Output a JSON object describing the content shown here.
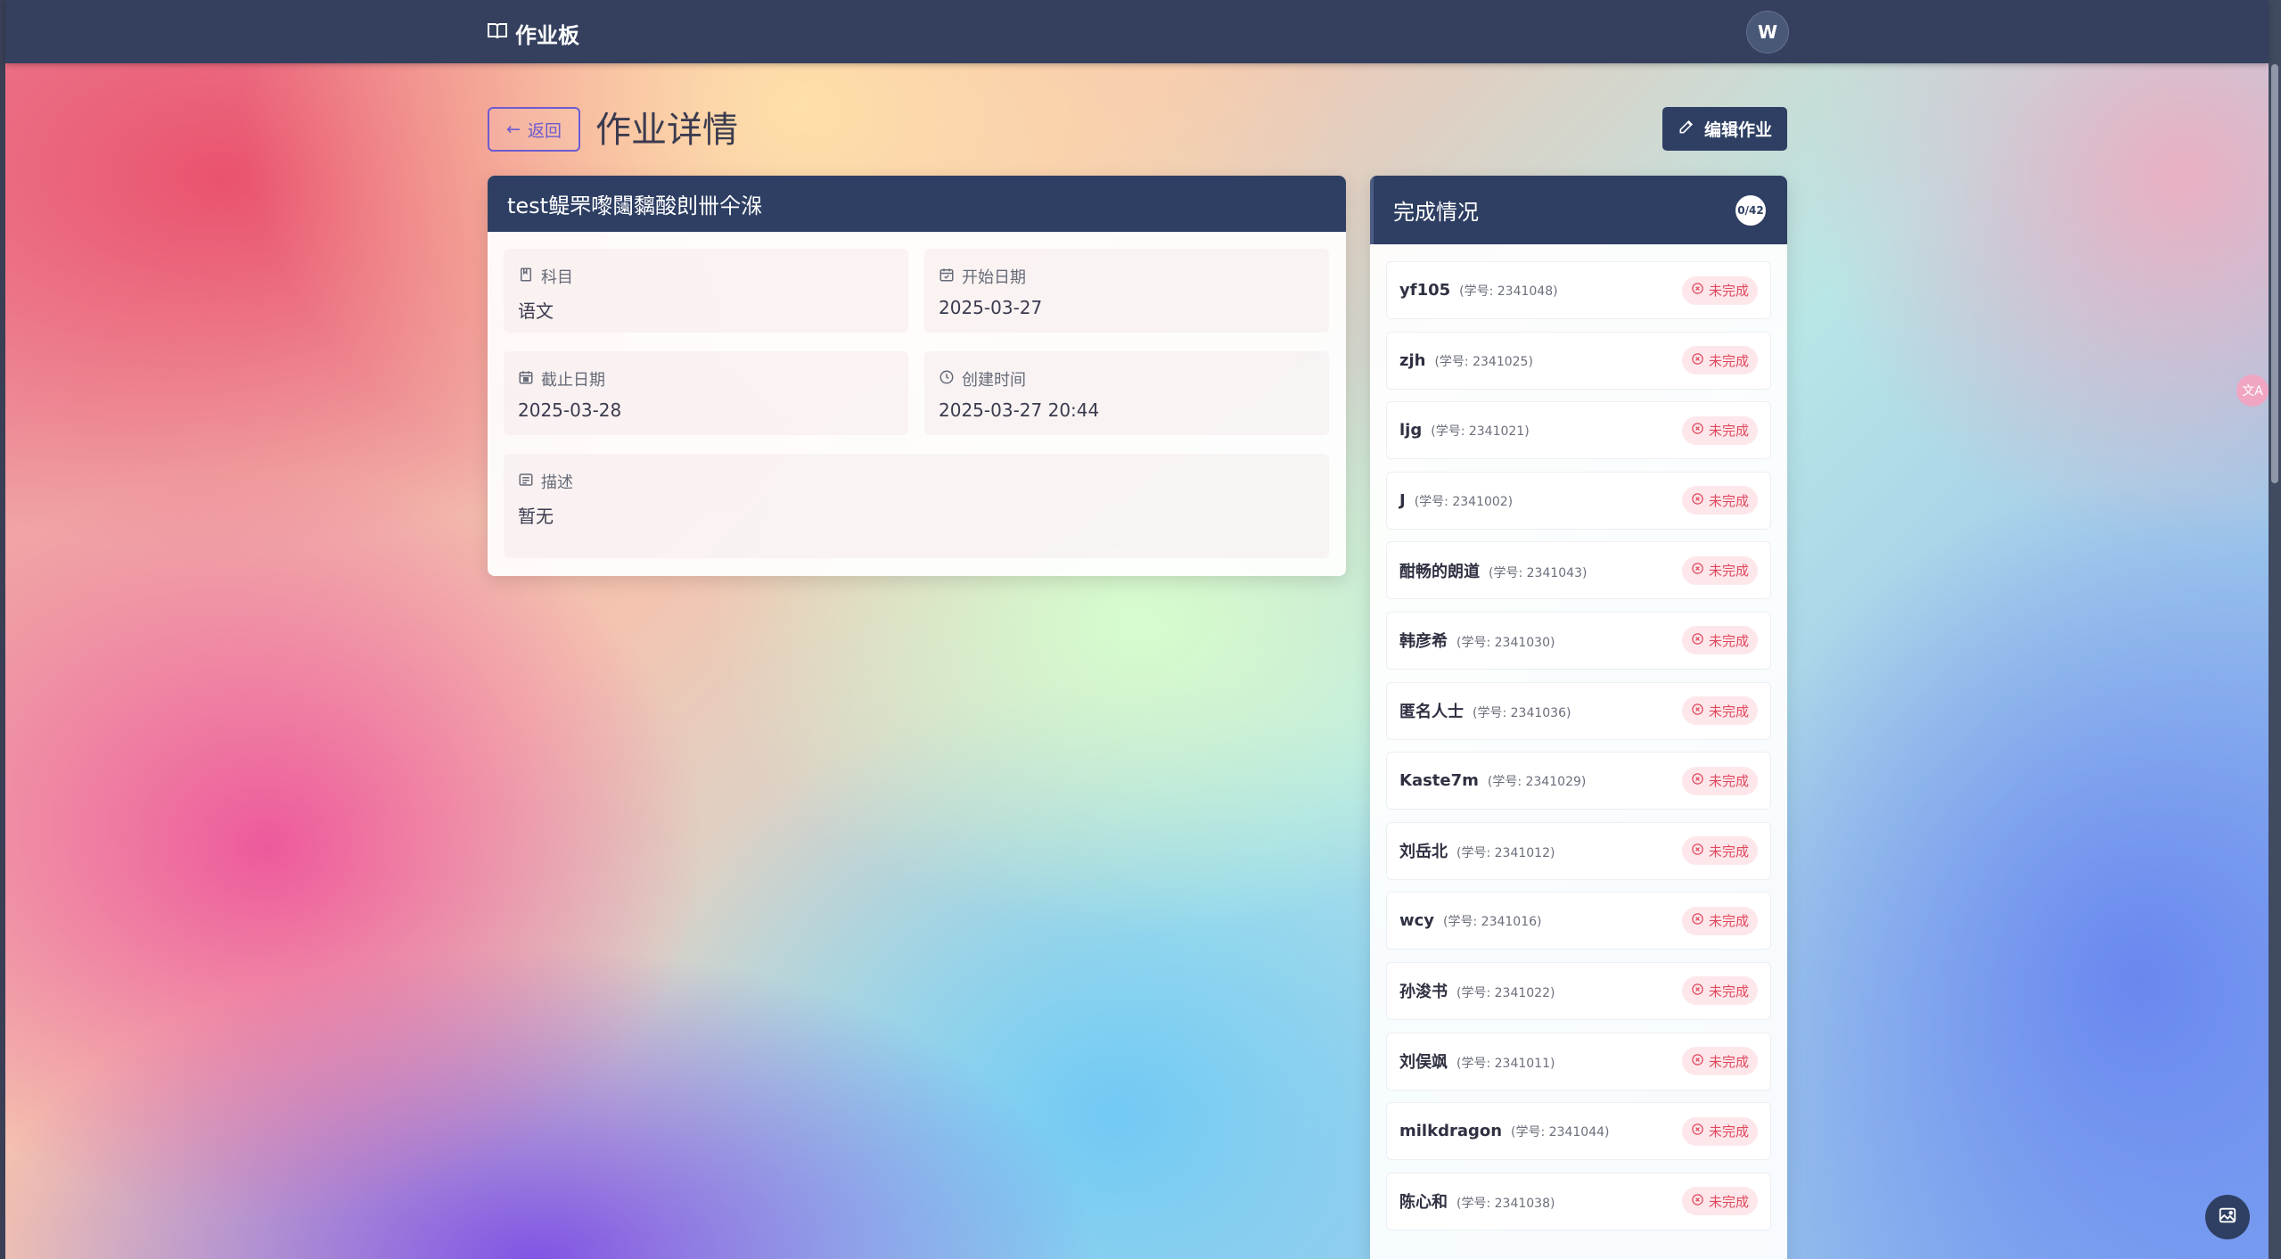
{
  "header": {
    "brand": "作业板",
    "avatar_letter": "W"
  },
  "toolbar": {
    "back_label": "返回",
    "page_title": "作业详情",
    "edit_label": "编辑作业"
  },
  "assignment": {
    "title": "test鳀罘嚟闧黐酸剆卌仐湺",
    "subject_label": "科目",
    "subject": "语文",
    "start_label": "开始日期",
    "start_date": "2025-03-27",
    "due_label": "截止日期",
    "due_date": "2025-03-28",
    "created_label": "创建时间",
    "created_at": "2025-03-27 20:44",
    "desc_label": "描述",
    "description": "暂无"
  },
  "completion": {
    "title": "完成情况",
    "count": "0/42",
    "status_label": "未完成",
    "students": [
      {
        "name": "yf105",
        "sid": "(学号: 2341048)"
      },
      {
        "name": "zjh",
        "sid": "(学号: 2341025)"
      },
      {
        "name": "ljg",
        "sid": "(学号: 2341021)"
      },
      {
        "name": "J",
        "sid": "(学号: 2341002)"
      },
      {
        "name": "酣畅的朗道",
        "sid": "(学号: 2341043)"
      },
      {
        "name": "韩彦希",
        "sid": "(学号: 2341030)"
      },
      {
        "name": "匿名人士",
        "sid": "(学号: 2341036)"
      },
      {
        "name": "Kaste7m",
        "sid": "(学号: 2341029)"
      },
      {
        "name": "刘岳北",
        "sid": "(学号: 2341012)"
      },
      {
        "name": "wcy",
        "sid": "(学号: 2341016)"
      },
      {
        "name": "孙浚书",
        "sid": "(学号: 2341022)"
      },
      {
        "name": "刘俣飒",
        "sid": "(学号: 2341011)"
      },
      {
        "name": "milkdragon",
        "sid": "(学号: 2341044)"
      },
      {
        "name": "陈心和",
        "sid": "(学号: 2341038)"
      }
    ]
  },
  "colors": {
    "navy": "#2e3f63",
    "accent": "#6d5bd0",
    "danger": "#e0485e"
  }
}
